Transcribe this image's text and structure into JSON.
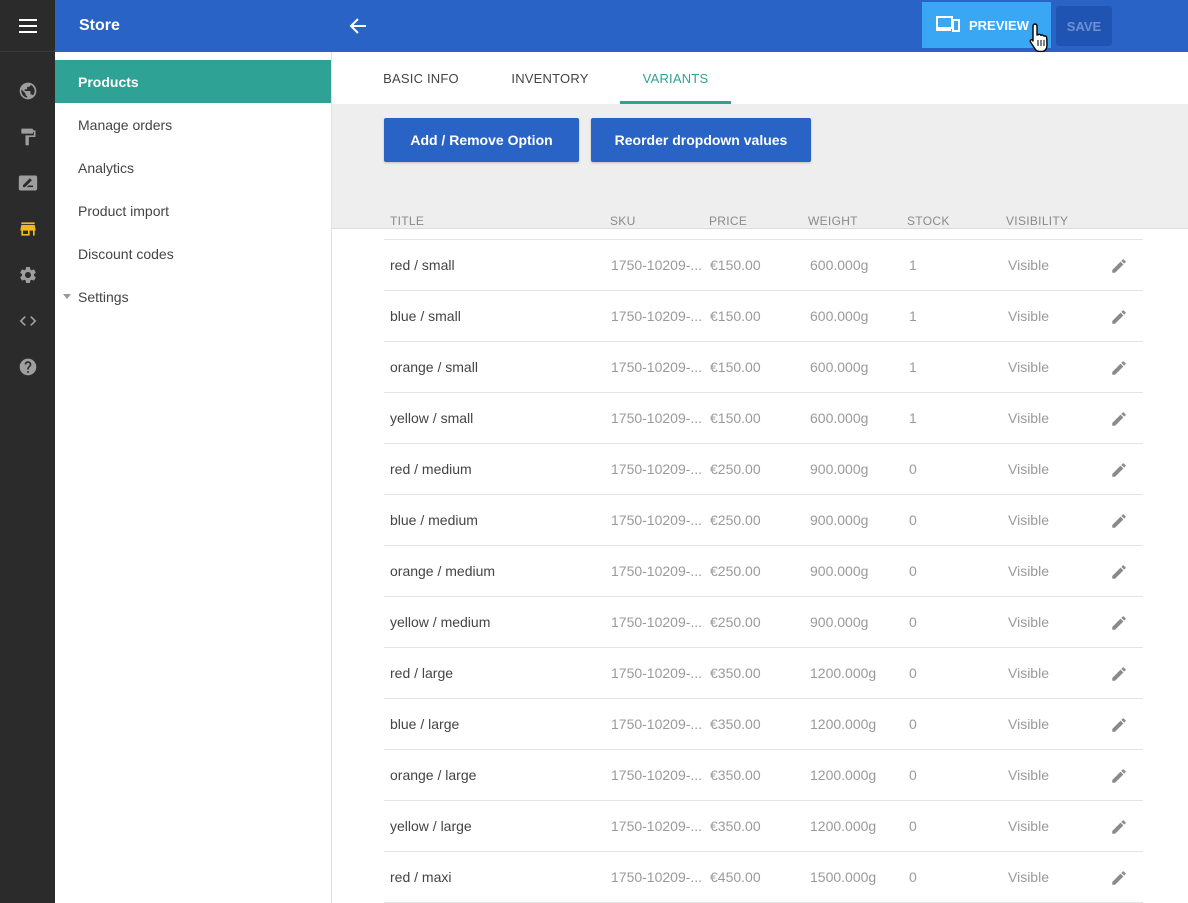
{
  "header": {
    "title": "Store",
    "preview_label": "PREVIEW",
    "save_label": "SAVE"
  },
  "sidebar": {
    "items": [
      {
        "label": "Products",
        "active": true
      },
      {
        "label": "Manage orders"
      },
      {
        "label": "Analytics"
      },
      {
        "label": "Product import"
      },
      {
        "label": "Discount codes"
      },
      {
        "label": "Settings",
        "expandable": true
      }
    ]
  },
  "rail": {
    "icons": [
      "menu-icon",
      "globe-icon",
      "paint-roller-icon",
      "edit-note-icon",
      "store-icon",
      "gear-icon",
      "code-icon",
      "help-icon"
    ],
    "active_color": "#f2b824"
  },
  "tabs": [
    {
      "label": "BASIC INFO"
    },
    {
      "label": "INVENTORY"
    },
    {
      "label": "VARIANTS",
      "active": true
    }
  ],
  "toolbar": {
    "add_remove_label": "Add / Remove Option",
    "reorder_label": "Reorder dropdown values"
  },
  "table": {
    "columns": [
      "TITLE",
      "SKU",
      "PRICE",
      "WEIGHT",
      "STOCK",
      "VISIBILITY"
    ],
    "rows": [
      {
        "title": "red / small",
        "sku": "1750-10209-...",
        "price": "€150.00",
        "weight": "600.000g",
        "stock": "1",
        "visibility": "Visible"
      },
      {
        "title": "blue / small",
        "sku": "1750-10209-...",
        "price": "€150.00",
        "weight": "600.000g",
        "stock": "1",
        "visibility": "Visible"
      },
      {
        "title": "orange / small",
        "sku": "1750-10209-...",
        "price": "€150.00",
        "weight": "600.000g",
        "stock": "1",
        "visibility": "Visible"
      },
      {
        "title": "yellow / small",
        "sku": "1750-10209-...",
        "price": "€150.00",
        "weight": "600.000g",
        "stock": "1",
        "visibility": "Visible"
      },
      {
        "title": "red / medium",
        "sku": "1750-10209-...",
        "price": "€250.00",
        "weight": "900.000g",
        "stock": "0",
        "visibility": "Visible"
      },
      {
        "title": "blue / medium",
        "sku": "1750-10209-...",
        "price": "€250.00",
        "weight": "900.000g",
        "stock": "0",
        "visibility": "Visible"
      },
      {
        "title": "orange / medium",
        "sku": "1750-10209-...",
        "price": "€250.00",
        "weight": "900.000g",
        "stock": "0",
        "visibility": "Visible"
      },
      {
        "title": "yellow / medium",
        "sku": "1750-10209-...",
        "price": "€250.00",
        "weight": "900.000g",
        "stock": "0",
        "visibility": "Visible"
      },
      {
        "title": "red / large",
        "sku": "1750-10209-...",
        "price": "€350.00",
        "weight": "1200.000g",
        "stock": "0",
        "visibility": "Visible"
      },
      {
        "title": "blue / large",
        "sku": "1750-10209-...",
        "price": "€350.00",
        "weight": "1200.000g",
        "stock": "0",
        "visibility": "Visible"
      },
      {
        "title": "orange / large",
        "sku": "1750-10209-...",
        "price": "€350.00",
        "weight": "1200.000g",
        "stock": "0",
        "visibility": "Visible"
      },
      {
        "title": "yellow / large",
        "sku": "1750-10209-...",
        "price": "€350.00",
        "weight": "1200.000g",
        "stock": "0",
        "visibility": "Visible"
      },
      {
        "title": "red / maxi",
        "sku": "1750-10209-...",
        "price": "€450.00",
        "weight": "1500.000g",
        "stock": "0",
        "visibility": "Visible"
      }
    ]
  }
}
